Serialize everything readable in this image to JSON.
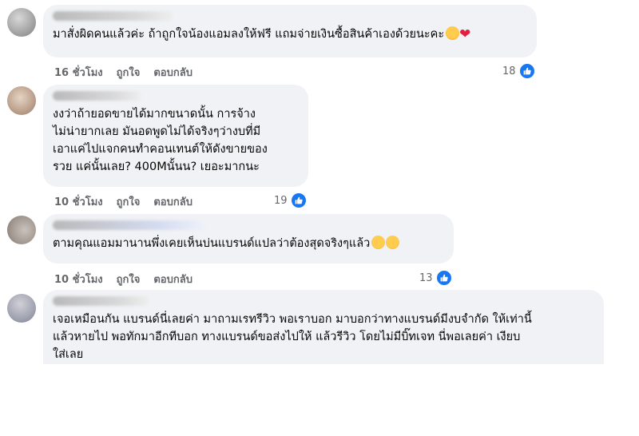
{
  "comments": [
    {
      "text": "มาสั่งผิดคนแล้วค่ะ ถ้าถูกใจน้องแอมลงให้ฟรี แถมจ่ายเงินซื้อสินค้าเองด้วยนะคะ",
      "time": "16 ชั่วโมง",
      "like_label": "ถูกใจ",
      "reply_label": "ตอบกลับ",
      "reactions": "18"
    },
    {
      "text": "งงว่าถ้ายอดขายได้มากขนาดนั้น การจ้าง\nไม่น่ายากเลย มันอดพูดไม่ได้จริงๆว่างบที่มี\nเอาแค่ไปแจกคนทำคอนเทนต์ให้ดังขายของ\nรวย แค่นั้นเลย? 400Mนั้นน? เยอะมากนะ",
      "time": "10 ชั่วโมง",
      "like_label": "ถูกใจ",
      "reply_label": "ตอบกลับ",
      "reactions": "19"
    },
    {
      "text": "ตามคุณแอมมานานพึ่งเคยเห็นบ่นแบรนด์แปลว่าต้องสุดจริงๆแล้ว",
      "time": "10 ชั่วโมง",
      "like_label": "ถูกใจ",
      "reply_label": "ตอบกลับ",
      "reactions": "13"
    },
    {
      "text": "เจอเหมือนกัน แบรนด์นี่เลยค่า มาถามเรทรีวิว พอเราบอก มาบอกว่าทางแบรนด์มีงบจำกัด ให้เท่านี้\nแล้วหายไป พอทักมาอีกทีบอก ทางแบรนด์ขอส่งไปให้ แล้วรีวิว โดยไม่มีบิ๊ทเจท นี่พอเลยค่า เงียบ\nใส่เลย"
    }
  ],
  "colors": {
    "bubble": "#f0f2f5",
    "meta_text": "#65676b",
    "like_blue": "#1877f2"
  },
  "icons": [
    "like-icon",
    "smiling-face-with-hearts-emoji",
    "red-heart-emoji",
    "grinning-sweat-emoji"
  ]
}
